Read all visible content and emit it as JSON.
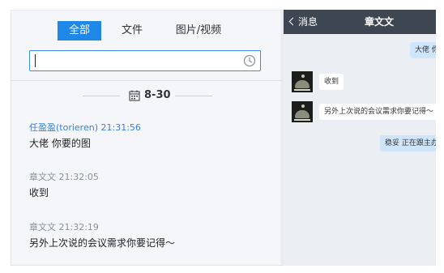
{
  "history": {
    "tabs": [
      {
        "label": "全部",
        "active": true
      },
      {
        "label": "文件",
        "active": false
      },
      {
        "label": "图片/视频",
        "active": false
      }
    ],
    "search": {
      "value": "",
      "placeholder": ""
    },
    "date_label": "8-30",
    "messages": [
      {
        "sender": "任盈盈(torieren)",
        "time": "21:31:56",
        "text": "大佬 你要的图",
        "sender_linked": true
      },
      {
        "sender": "章文文",
        "time": "21:32:05",
        "text": "收到",
        "sender_linked": false
      },
      {
        "sender": "章文文",
        "time": "21:32:19",
        "text": "另外上次说的会议需求你要记得～",
        "sender_linked": false
      }
    ]
  },
  "chat": {
    "back_label": "消息",
    "title": "章文文",
    "bubbles": [
      {
        "text": "大佬 你",
        "side": "right"
      },
      {
        "text": "收到",
        "side": "left"
      },
      {
        "text": "另外上次说的会议需求你要记得～",
        "side": "left"
      },
      {
        "text": "稳妥 正在跟主办",
        "side": "right"
      }
    ]
  },
  "icons": {
    "search_history": "clock-icon",
    "date": "calendar-icon",
    "back": "chevron-left-icon"
  },
  "colors": {
    "accent": "#1f87e8",
    "chat_header": "#3e4651",
    "link": "#3b7fd6",
    "my_bubble": "#cfe5fb"
  }
}
